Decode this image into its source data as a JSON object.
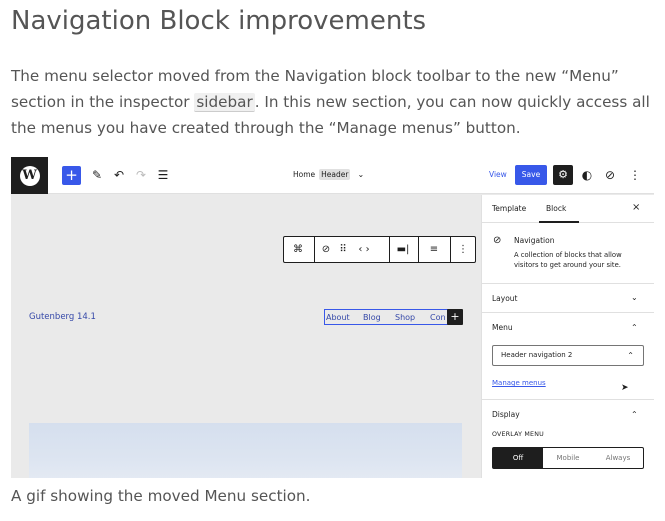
{
  "article": {
    "title": "Navigation Block improvements",
    "body_part1": "The menu selector moved from the Navigation block toolbar to the new “Menu” section in the inspector ",
    "body_code": "sidebar",
    "body_part2": ". In this new section, you can now quickly access all the menus you have created through the “Manage menus” button.",
    "caption": "A gif showing the moved Menu section."
  },
  "editor": {
    "top_toolbar": {
      "logo_letter": "W",
      "add_label": "+",
      "template_home": "Home",
      "template_part": "Header",
      "view_label": "View",
      "save_label": "Save"
    },
    "canvas": {
      "site_title": "Gutenberg 14.1",
      "nav_items": [
        "About",
        "Blog",
        "Shop",
        "Con"
      ],
      "nav_add": "+"
    },
    "inspector": {
      "tabs": [
        "Template",
        "Block"
      ],
      "active_tab": "Block",
      "close": "×",
      "block_title": "Navigation",
      "block_description": "A collection of blocks that allow visitors to get around your site.",
      "layout_label": "Layout",
      "menu_label": "Menu",
      "menu_selected": "Header navigation 2",
      "manage_menus_label": "Manage menus",
      "display_label": "Display",
      "overlay_menu_label": "OVERLAY MENU",
      "overlay_options": [
        "Off",
        "Mobile",
        "Always"
      ],
      "overlay_selected": "Off"
    },
    "colors": {
      "accent": "#3858e9",
      "dark": "#1e1e1e",
      "link_text": "#3548a8"
    },
    "icons": [
      "wordpress-logo-icon",
      "add-icon",
      "pen-icon",
      "undo-icon",
      "redo-icon",
      "list-view-icon",
      "chevron-down-icon",
      "settings-gear-icon",
      "contrast-icon",
      "navigation-compass-icon",
      "more-vertical-icon",
      "close-icon",
      "chevron-up-icon",
      "cursor-icon"
    ]
  }
}
